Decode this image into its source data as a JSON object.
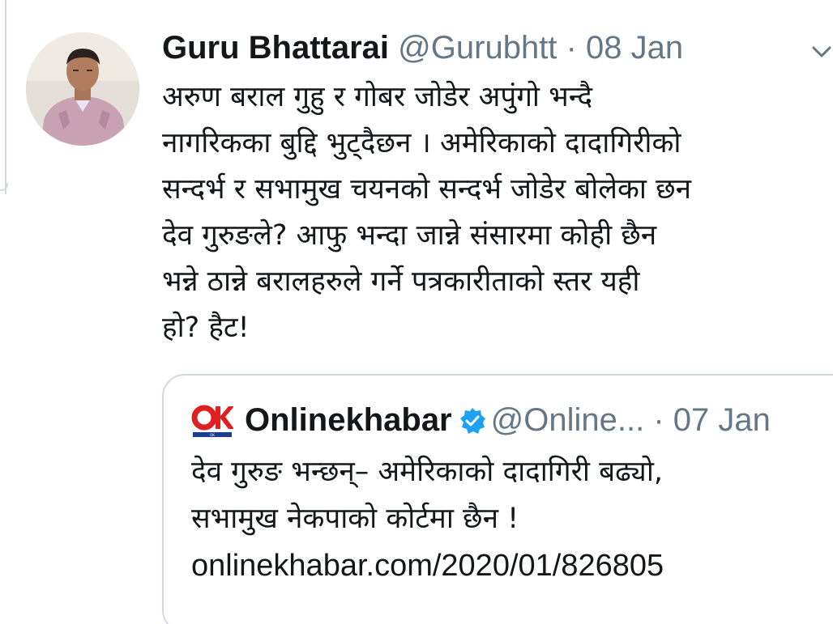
{
  "tweet": {
    "author_name": "Guru Bhattarai",
    "author_handle": "@Gurubhtt",
    "separator": "·",
    "date": "08 Jan",
    "caret_icon": "chevron-down-icon",
    "text_lines": [
      "अरुण बराल गुहु र गोबर जोडेर अपुंगो भन्दै",
      "नागरिकका बुद्दि भुट्दैछन । अमेरिकाको दादागिरीको",
      "सन्दर्भ र सभामुख चयनको सन्दर्भ जोडेर बोलेका छन",
      "देव गुरुङले? आफु भन्दा जान्ने संसारमा कोही छैन",
      "भन्ने ठान्ने बरालहरुले गर्ने पत्रकारीताको स्तर यही",
      "हो? हैट!"
    ]
  },
  "quote": {
    "logo_icon": "onlinekhabar-logo",
    "logo_text": "OK",
    "author_name": "Onlinekhabar",
    "verified_icon": "verified-badge-icon",
    "author_handle": "@Online...",
    "separator": "·",
    "date": "07 Jan",
    "text_lines": [
      "देव गुरुङ भन्छन्– अमेरिकाको दादागिरी बढ्यो,",
      "सभामुख नेकपाको कोर्टमा छैन !"
    ],
    "link": "onlinekhabar.com/2020/01/826805"
  },
  "colors": {
    "text_primary": "#14171a",
    "text_secondary": "#657786",
    "border": "#cfd9de",
    "verified_blue": "#1da1f2",
    "logo_red": "#e02020",
    "logo_blue": "#1f3b8f"
  }
}
